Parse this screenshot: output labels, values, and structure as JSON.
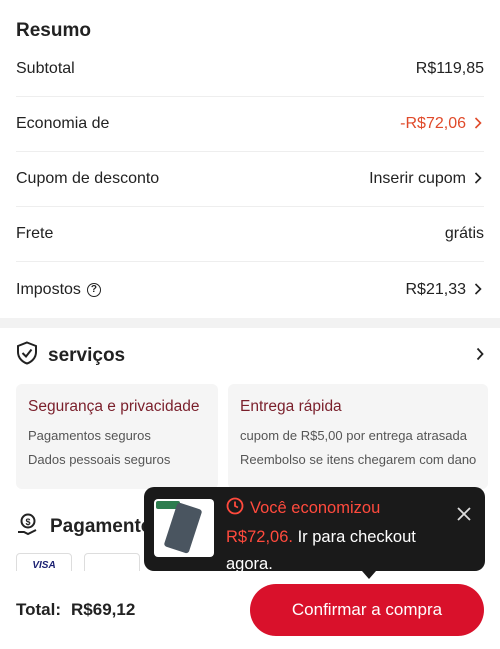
{
  "summary": {
    "title": "Resumo",
    "rows": [
      {
        "label": "Subtotal",
        "value": "R$119,85"
      },
      {
        "label": "Economia de",
        "value": "-R$72,06"
      },
      {
        "label": "Cupom de desconto",
        "value": "Inserir cupom"
      },
      {
        "label": "Frete",
        "value": "grátis"
      },
      {
        "label": "Impostos",
        "value": "R$21,33"
      }
    ]
  },
  "services": {
    "title": "serviços",
    "cards": [
      {
        "title": "Segurança e privacidade",
        "lines": [
          "Pagamentos seguros",
          "Dados pessoais seguros"
        ]
      },
      {
        "title": "Entrega rápida",
        "lines": [
          "cupom de R$5,00 por entrega atrasada",
          "Reembolso se itens chegarem com dano"
        ]
      }
    ]
  },
  "payments": {
    "title": "Pagamento",
    "logos": [
      "VISA"
    ]
  },
  "toast": {
    "heading": "Você economizou",
    "amount": "R$72,06.",
    "message": "Ir para checkout agora."
  },
  "footer": {
    "total_label": "Total:",
    "total_value": "R$69,12",
    "confirm_label": "Confirmar a compra"
  },
  "colors": {
    "accent": "#d9112b",
    "discount": "#e04a2a",
    "card_title": "#7a1f2b"
  }
}
